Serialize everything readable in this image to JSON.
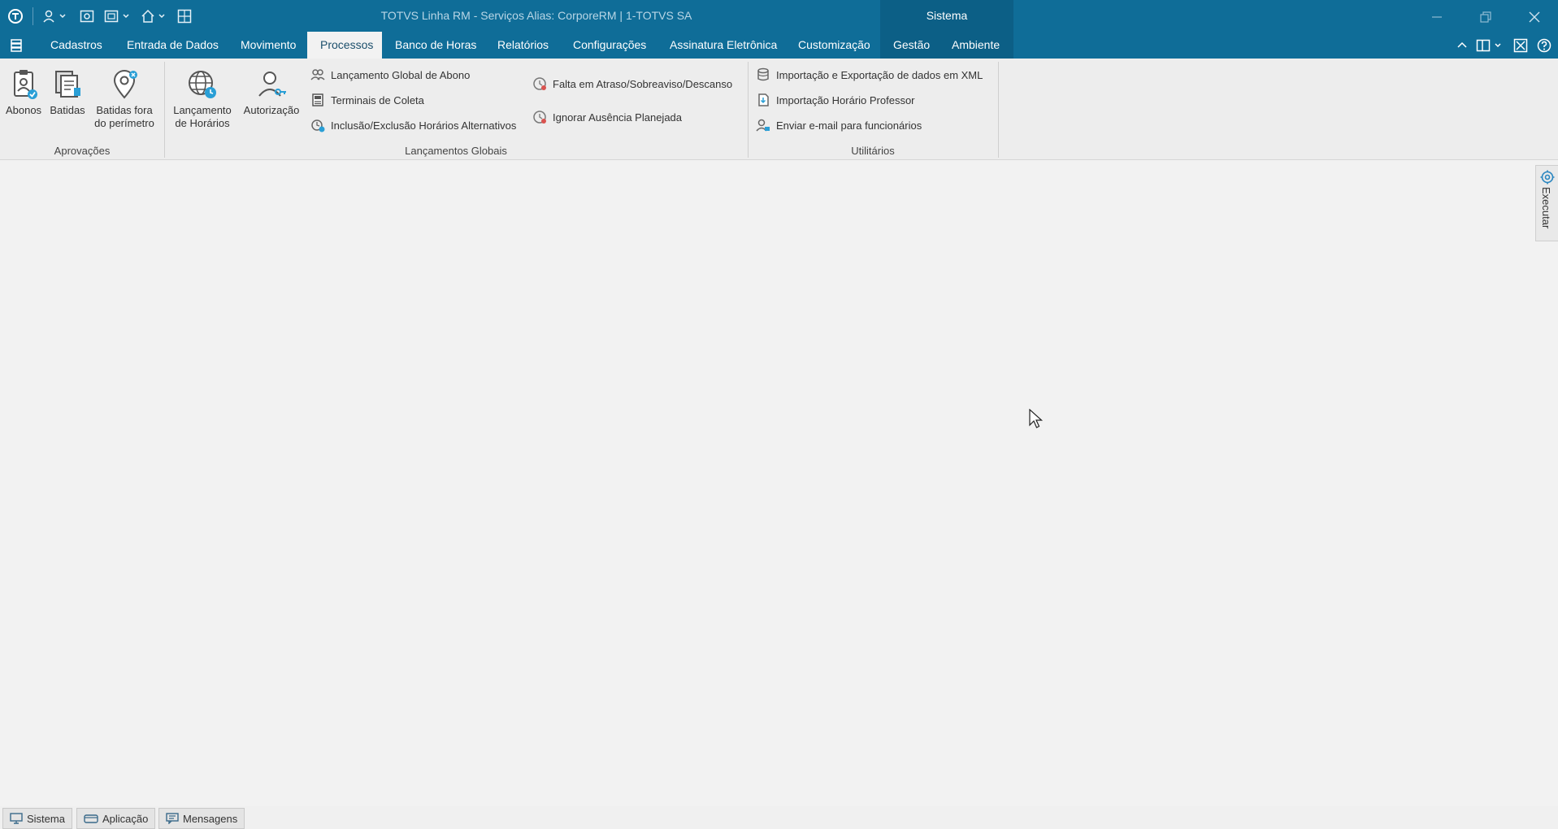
{
  "window": {
    "title": "TOTVS Linha RM - Serviços  Alias: CorporeRM | 1-TOTVS SA",
    "context_tab": "Sistema"
  },
  "menu": {
    "items": [
      "Cadastros",
      "Entrada de Dados",
      "Movimento",
      "Processos",
      "Banco de Horas",
      "Relatórios",
      "Configurações",
      "Assinatura Eletrônica",
      "Customização",
      "Gestão",
      "Ambiente"
    ],
    "active": "Processos"
  },
  "ribbon": {
    "aprovacoes": {
      "label": "Aprovações",
      "abonos": "Abonos",
      "batidas": "Batidas",
      "batidas_fora_1": "Batidas fora",
      "batidas_fora_2": "do perímetro"
    },
    "lancamentos_globais": {
      "label": "Lançamentos Globais",
      "lanc_horarios_1": "Lançamento",
      "lanc_horarios_2": "de Horários",
      "autorizacao": "Autorização",
      "global_abono": "Lançamento Global de Abono",
      "terminais": "Terminais de Coleta",
      "inclusao": "Inclusão/Exclusão Horários Alternativos",
      "falta": "Falta em Atraso/Sobreaviso/Descanso",
      "ignorar": "Ignorar Ausência Planejada"
    },
    "utilitarios": {
      "label": "Utilitários",
      "xml": "Importação e Exportação de dados em XML",
      "professor": "Importação Horário Professor",
      "email": "Enviar e-mail para funcionários"
    }
  },
  "side_panel": {
    "executar": "Executar"
  },
  "statusbar": {
    "sistema": "Sistema",
    "aplicacao": "Aplicação",
    "mensagens": "Mensagens"
  },
  "colors": {
    "titlebar": "#0f6d98",
    "context_tab": "#0c5f86",
    "ribbon": "#ededed",
    "workspace": "#f2f2f2"
  }
}
